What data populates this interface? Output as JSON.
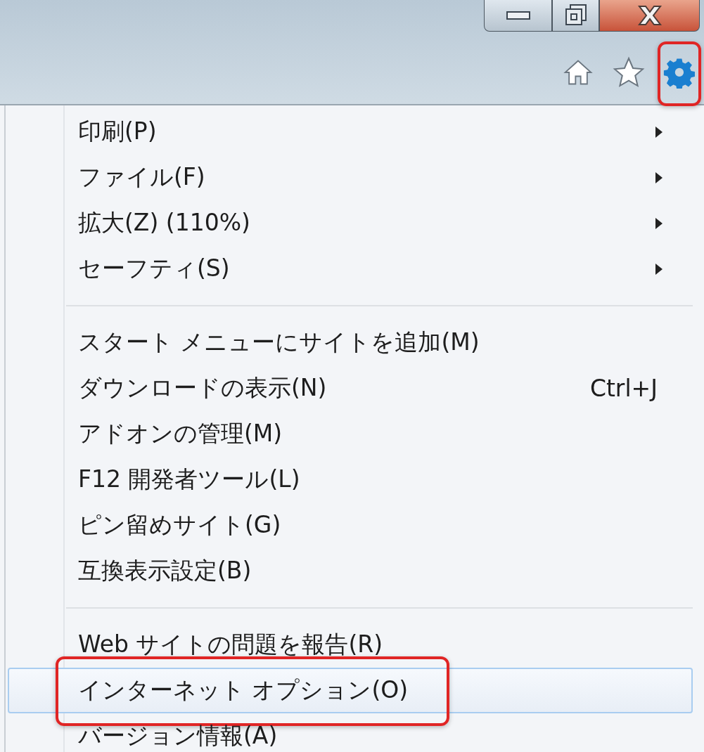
{
  "window_controls": [
    {
      "kind": "minimize"
    },
    {
      "kind": "restore"
    },
    {
      "kind": "close"
    }
  ],
  "toolbar": [
    {
      "kind": "home",
      "annotated": false
    },
    {
      "kind": "favorites",
      "annotated": false
    },
    {
      "kind": "tools",
      "annotated": true
    }
  ],
  "menu": {
    "groups": [
      {
        "items": [
          {
            "label": "印刷(P)",
            "submenu": true,
            "selected": false,
            "annotated": false
          },
          {
            "label": "ファイル(F)",
            "submenu": true,
            "selected": false,
            "annotated": false
          },
          {
            "label": "拡大(Z) (110%)",
            "submenu": true,
            "selected": false,
            "annotated": false
          },
          {
            "label": "セーフティ(S)",
            "submenu": true,
            "selected": false,
            "annotated": false
          }
        ]
      },
      {
        "items": [
          {
            "label": "スタート メニューにサイトを追加(M)",
            "submenu": false,
            "selected": false,
            "annotated": false
          },
          {
            "label": "ダウンロードの表示(N)",
            "shortcut": "Ctrl+J",
            "submenu": false,
            "selected": false,
            "annotated": false
          },
          {
            "label": "アドオンの管理(M)",
            "submenu": false,
            "selected": false,
            "annotated": false
          },
          {
            "label": "F12 開発者ツール(L)",
            "submenu": false,
            "selected": false,
            "annotated": false
          },
          {
            "label": "ピン留めサイト(G)",
            "submenu": false,
            "selected": false,
            "annotated": false
          },
          {
            "label": "互換表示設定(B)",
            "submenu": false,
            "selected": false,
            "annotated": false
          }
        ]
      },
      {
        "items": [
          {
            "label": "Web サイトの問題を報告(R)",
            "submenu": false,
            "selected": false,
            "annotated": false
          },
          {
            "label": "インターネット オプション(O)",
            "submenu": false,
            "selected": true,
            "annotated": true
          },
          {
            "label": "バージョン情報(A)",
            "submenu": false,
            "selected": false,
            "annotated": false
          }
        ]
      }
    ]
  }
}
